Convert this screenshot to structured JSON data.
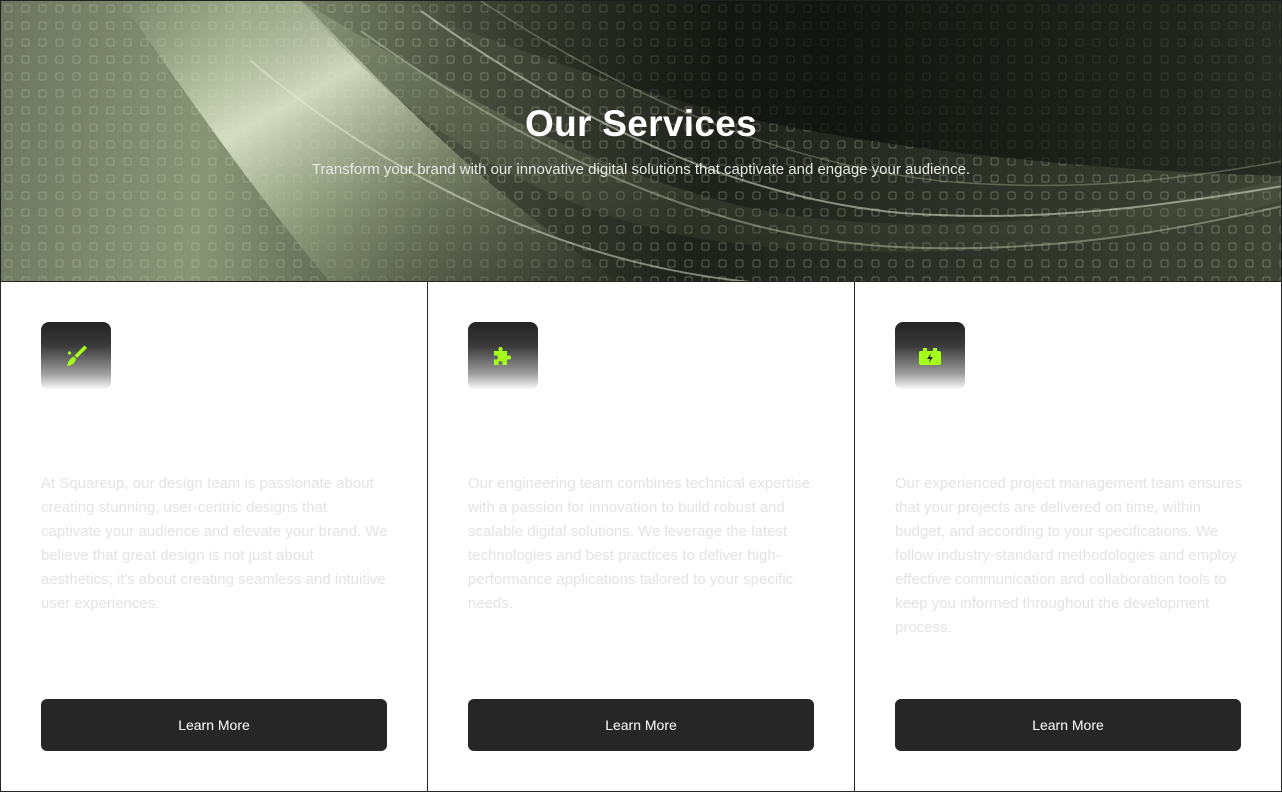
{
  "hero": {
    "title": "Our Services",
    "subtitle": "Transform your brand with our innovative digital solutions that captivate and engage your audience."
  },
  "colors": {
    "accent": "#a4ff1a",
    "button": "#262626",
    "description_text": "#e3e3e3"
  },
  "services": [
    {
      "icon": "paintbrush-icon",
      "title": "",
      "description": "At Squareup, our design team is passionate about creating stunning, user-centric designs that captivate your audience and elevate your brand. We believe that great design is not just about aesthetics; it's about creating seamless and intuitive user experiences.",
      "button_label": "Learn More"
    },
    {
      "icon": "puzzle-icon",
      "title": "",
      "description": "Our engineering team combines technical expertise with a passion for innovation to build robust and scalable digital solutions. We leverage the latest technologies and best practices to deliver high-performance applications tailored to your specific needs.",
      "button_label": "Learn More"
    },
    {
      "icon": "battery-charging-icon",
      "title": "",
      "description": "Our experienced project management team ensures that your projects are delivered on time, within budget, and according to your specifications. We follow industry-standard methodologies and employ effective communication and collaboration tools to keep you informed throughout the development process.",
      "button_label": "Learn More"
    }
  ]
}
